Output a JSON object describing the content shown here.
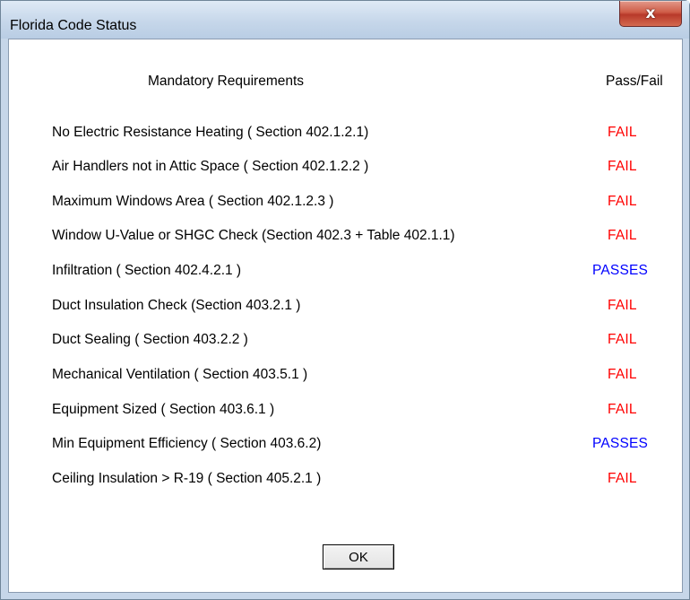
{
  "window": {
    "title": "Florida Code Status",
    "close_glyph": "x"
  },
  "headers": {
    "requirements": "Mandatory Requirements",
    "pass_fail": "Pass/Fail"
  },
  "rows": [
    {
      "label": "No Electric Resistance Heating ( Section 402.1.2.1)",
      "status": "FAIL",
      "status_color": "#ff0000"
    },
    {
      "label": "Air Handlers not in Attic Space ( Section 402.1.2.2 )",
      "status": "FAIL",
      "status_color": "#ff0000"
    },
    {
      "label": "Maximum Windows Area ( Section 402.1.2.3 )",
      "status": "FAIL",
      "status_color": "#ff0000"
    },
    {
      "label": "Window U-Value or SHGC Check (Section 402.3 + Table 402.1.1)",
      "status": "FAIL",
      "status_color": "#ff0000"
    },
    {
      "label": "Infiltration ( Section 402.4.2.1 )",
      "status": "PASSES",
      "status_color": "#0000ff"
    },
    {
      "label": "Duct Insulation Check (Section 403.2.1 )",
      "status": "FAIL",
      "status_color": "#ff0000"
    },
    {
      "label": "Duct Sealing ( Section 403.2.2 )",
      "status": "FAIL",
      "status_color": "#ff0000"
    },
    {
      "label": "Mechanical Ventilation ( Section 403.5.1 )",
      "status": "FAIL",
      "status_color": "#ff0000"
    },
    {
      "label": "Equipment Sized ( Section 403.6.1 )",
      "status": "FAIL",
      "status_color": "#ff0000"
    },
    {
      "label": "Min Equipment Efficiency ( Section 403.6.2)",
      "status": "PASSES",
      "status_color": "#0000ff"
    },
    {
      "label": "Ceiling Insulation > R-19 ( Section 405.2.1 )",
      "status": "FAIL",
      "status_color": "#ff0000"
    }
  ],
  "buttons": {
    "ok_label": "OK"
  }
}
